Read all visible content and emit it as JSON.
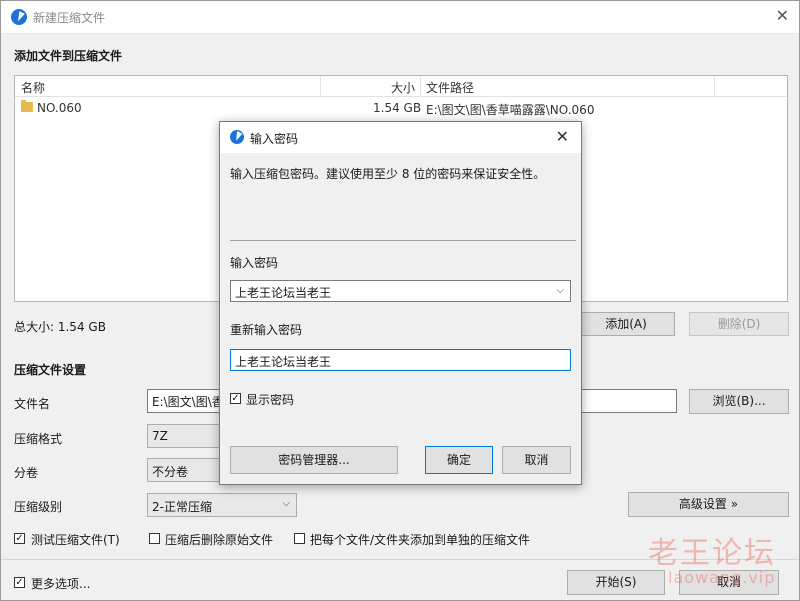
{
  "window": {
    "title": "新建压缩文件"
  },
  "add_section": {
    "title": "添加文件到压缩文件",
    "columns": [
      "名称",
      "大小",
      "文件路径"
    ],
    "rows": [
      {
        "name": "NO.060",
        "size": "1.54 GB",
        "path": "E:\\图文\\图\\香草喵露露\\NO.060"
      }
    ],
    "total_size": "总大小: 1.54 GB",
    "add_button": "添加(A)",
    "delete_button": "删除(D)"
  },
  "settings": {
    "title": "压缩文件设置",
    "filename_label": "文件名",
    "filename_value": "E:\\图文\\图\\香",
    "browse_button": "浏览(B)...",
    "format_label": "压缩格式",
    "format_value": "7Z",
    "split_label": "分卷",
    "split_value": "不分卷",
    "level_label": "压缩级别",
    "level_value": "2-正常压缩",
    "advanced_button": "高级设置 »",
    "test_checkbox": "测试压缩文件(T)",
    "delete_after_checkbox": "压缩后删除原始文件",
    "separate_checkbox": "把每个文件/文件夹添加到单独的压缩文件",
    "more_options_checkbox": "更多选项...",
    "start_button": "开始(S)",
    "cancel_button": "取消"
  },
  "dialog": {
    "title": "输入密码",
    "description": "输入压缩包密码。建议使用至少 8 位的密码来保证安全性。",
    "password_label": "输入密码",
    "password_value": "上老王论坛当老王",
    "reenter_label": "重新输入密码",
    "reenter_value": "上老王论坛当老王",
    "show_password": "显示密码",
    "manager_button": "密码管理器...",
    "ok_button": "确定",
    "cancel_button": "取消"
  },
  "watermark": {
    "text_cn": "老王论坛",
    "text_en": "laowang.vip"
  }
}
